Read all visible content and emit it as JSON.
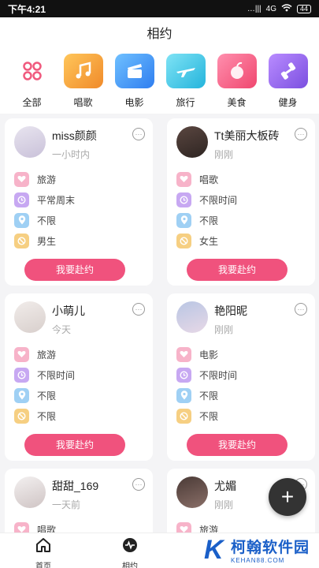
{
  "status_bar": {
    "time": "下午4:21",
    "signal": "…|||",
    "network": "4G",
    "battery": "44"
  },
  "header": {
    "title": "相约"
  },
  "categories": [
    {
      "label": "全部",
      "icon": "grid-icon",
      "color": "#f05a7e"
    },
    {
      "label": "唱歌",
      "icon": "music-icon",
      "color": "#f5a23a"
    },
    {
      "label": "电影",
      "icon": "clapperboard-icon",
      "color": "#3a8df0"
    },
    {
      "label": "旅行",
      "icon": "airplane-icon",
      "color": "#2fc3e0"
    },
    {
      "label": "美食",
      "icon": "fruit-icon",
      "color": "#f0527d"
    },
    {
      "label": "健身",
      "icon": "dumbbell-icon",
      "color": "#9b63e8"
    }
  ],
  "cards": [
    {
      "name": "miss颜颜",
      "time": "一小时内",
      "activity": "旅游",
      "when": "平常周末",
      "where": "不限",
      "gender": "男生",
      "button": "我要赴约"
    },
    {
      "name": "Tt美丽大板砖",
      "time": "刚刚",
      "activity": "唱歌",
      "when": "不限时间",
      "where": "不限",
      "gender": "女生",
      "button": "我要赴约"
    },
    {
      "name": "小萌儿",
      "time": "今天",
      "activity": "旅游",
      "when": "不限时间",
      "where": "不限",
      "gender": "不限",
      "button": "我要赴约"
    },
    {
      "name": "艳阳昵",
      "time": "刚刚",
      "activity": "电影",
      "when": "不限时间",
      "where": "不限",
      "gender": "不限",
      "button": "我要赴约"
    },
    {
      "name": "甜甜_169",
      "time": "一天前",
      "activity": "唱歌"
    },
    {
      "name": "尤媚",
      "time": "刚刚",
      "activity": "旅游"
    }
  ],
  "fab": {
    "label": "+"
  },
  "tabbar": [
    {
      "label": "首页",
      "icon": "home-icon"
    },
    {
      "label": "相约",
      "icon": "pulse-icon"
    }
  ],
  "watermark": {
    "name": "柯翰软件园",
    "url": "KEHAN88.COM"
  },
  "colors": {
    "accent": "#f0527d",
    "text": "#222222",
    "subtext": "#aaaaaa"
  }
}
